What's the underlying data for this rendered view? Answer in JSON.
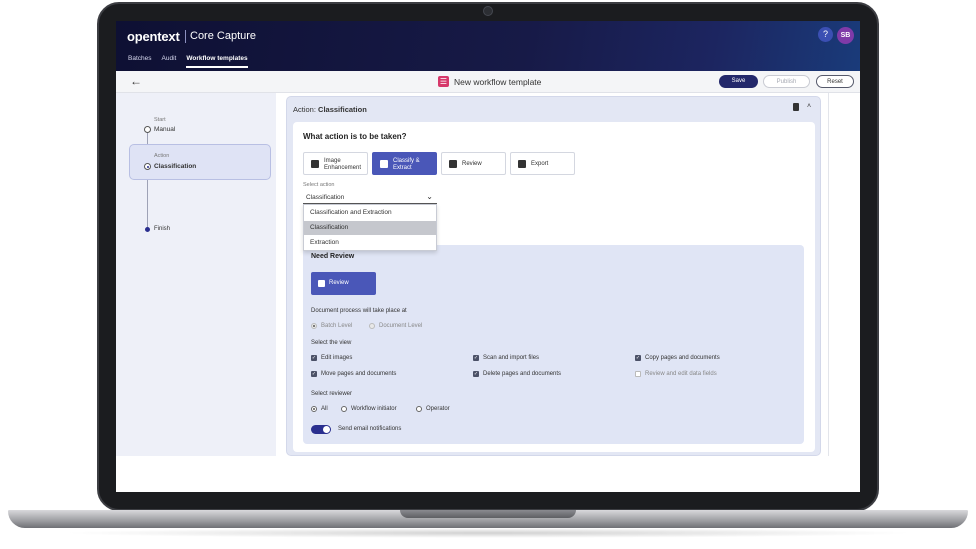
{
  "header": {
    "logo": "opentext",
    "product": "Core Capture",
    "nav": [
      "Batches",
      "Audit",
      "Workflow templates"
    ],
    "help_label": "?",
    "avatar_initials": "SB"
  },
  "toolbar": {
    "back_icon": "arrow-left-icon",
    "title": "New workflow template",
    "save_label": "Save",
    "publish_label": "Publish",
    "reset_label": "Reset"
  },
  "workflow": {
    "start_label": "Start",
    "start_value": "Manual",
    "action_label": "Action",
    "action_value": "Classification",
    "finish_label": "Finish"
  },
  "card": {
    "title_prefix": "Action:",
    "title_value": "Classification",
    "question": "What action is to be taken?",
    "tiles": [
      {
        "label1": "Image",
        "label2": "Enhancement",
        "icon": "image-icon"
      },
      {
        "label1": "Classify &",
        "label2": "Extract",
        "icon": "hierarchy-icon"
      },
      {
        "label1": "Review",
        "label2": "",
        "icon": "review-icon"
      },
      {
        "label1": "Export",
        "label2": "",
        "icon": "export-icon"
      }
    ],
    "select_label": "Select action",
    "select_value": "Classification",
    "dropdown_options": [
      "Classification and Extraction",
      "Classification",
      "Extraction"
    ]
  },
  "review": {
    "heading": "Need Review",
    "button_label": "Review",
    "process_label": "Document process will take place at",
    "process_options": [
      "Batch Level",
      "Document Level"
    ],
    "view_label": "Select the view",
    "view_options": [
      "Edit images",
      "Scan and import files",
      "Copy pages and documents",
      "Move pages and documents",
      "Delete pages and documents",
      "Review and edit data fields"
    ],
    "reviewer_label": "Select reviewer",
    "reviewer_options": [
      "All",
      "Workflow initiator",
      "Operator"
    ],
    "email_label": "Send email notifications"
  }
}
